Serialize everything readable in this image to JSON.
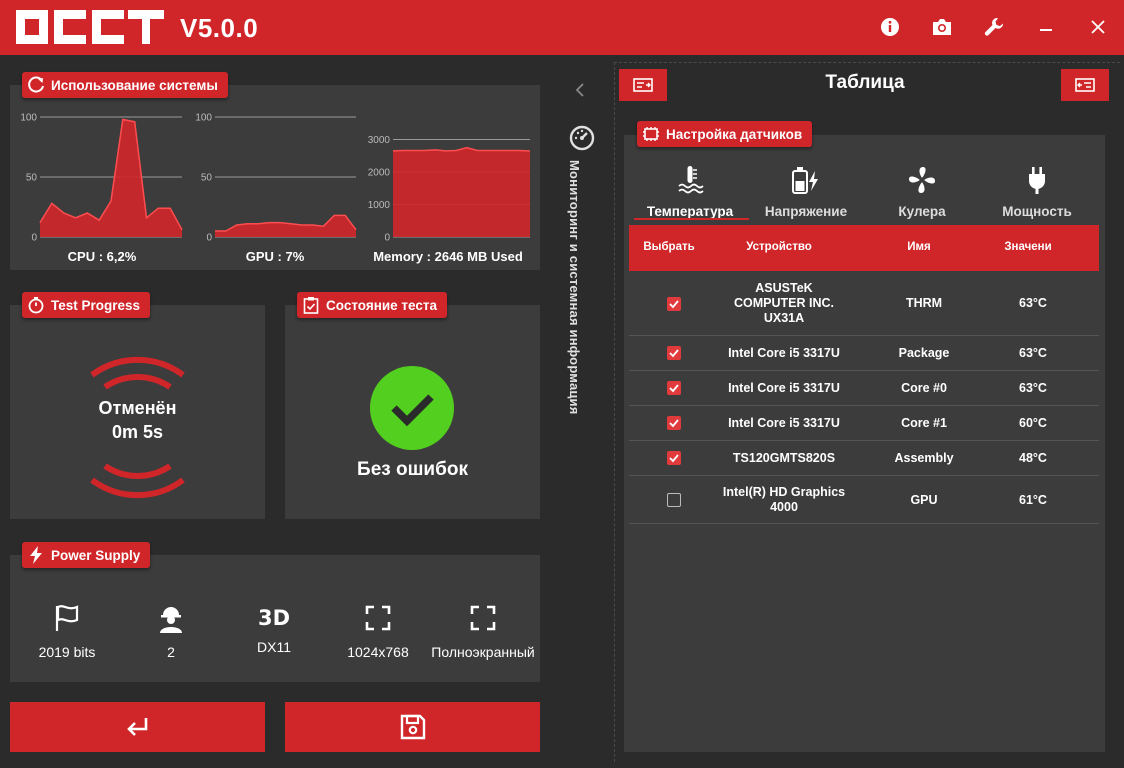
{
  "app": {
    "version": "V5.0.0"
  },
  "colors": {
    "accent": "#d0262a",
    "panel": "#3c3c3c",
    "background": "#2b2b2b",
    "ok_green": "#52cf1f"
  },
  "system_usage": {
    "title": "Использование системы",
    "charts": [
      {
        "name": "cpu",
        "caption": "CPU : 6,2%",
        "ticks": [
          "100",
          "50",
          "0"
        ],
        "ylim": [
          0,
          100
        ]
      },
      {
        "name": "gpu",
        "caption": "GPU : 7%",
        "ticks": [
          "100",
          "50",
          "0"
        ],
        "ylim": [
          0,
          100
        ]
      },
      {
        "name": "memory",
        "caption": "Memory : 2646 MB Used",
        "ticks": [
          "3000",
          "2000",
          "1000",
          "0"
        ],
        "ylim": [
          0,
          3200
        ]
      }
    ]
  },
  "chart_data": [
    {
      "type": "area",
      "series": [
        {
          "values": [
            12,
            28,
            20,
            16,
            20,
            14,
            30,
            98,
            96,
            16,
            24,
            24,
            6
          ]
        }
      ],
      "ylim": [
        0,
        100
      ],
      "xlabel": "CPU : 6,2%"
    },
    {
      "type": "area",
      "series": [
        {
          "values": [
            5,
            5,
            10,
            11,
            11,
            12,
            12,
            11,
            10,
            10,
            9,
            18,
            18,
            6
          ]
        }
      ],
      "ylim": [
        0,
        100
      ],
      "xlabel": "GPU : 7%"
    },
    {
      "type": "area",
      "series": [
        {
          "values": [
            2650,
            2660,
            2660,
            2660,
            2680,
            2650,
            2660,
            2750,
            2660,
            2660,
            2660,
            2660,
            2660,
            2646
          ]
        }
      ],
      "ylim": [
        0,
        3200
      ],
      "xlabel": "Memory : 2646 MB Used"
    }
  ],
  "test_progress": {
    "title": "Test Progress",
    "status": "Отменён",
    "time": "0m 5s"
  },
  "test_state": {
    "title": "Состояние теста",
    "result": "Без ошибок"
  },
  "power_supply": {
    "title": "Power Supply",
    "items": [
      {
        "icon": "flag-icon",
        "label": "2019 bits"
      },
      {
        "icon": "worker-icon",
        "label": "2"
      },
      {
        "icon": "3d-icon",
        "icon_text": "3D",
        "label": "DX11"
      },
      {
        "icon": "fullscreen-icon",
        "label": "1024x768"
      },
      {
        "icon": "fullscreen-icon",
        "label": "Полноэкранный"
      }
    ]
  },
  "side_tab": {
    "label": "Мониторинг и системная информация"
  },
  "right": {
    "title": "Таблица",
    "sensor_settings": "Настройка датчиков",
    "tabs": [
      {
        "label": "Температура",
        "active": true
      },
      {
        "label": "Напряжение",
        "active": false
      },
      {
        "label": "Кулера",
        "active": false
      },
      {
        "label": "Мощность",
        "active": false
      }
    ],
    "columns": [
      "Выбрать",
      "Устройство",
      "Имя",
      "Значени"
    ],
    "rows": [
      {
        "checked": true,
        "device": "ASUSTeK COMPUTER INC. UX31A",
        "name": "THRM",
        "value": "63°C"
      },
      {
        "checked": true,
        "device": "Intel Core i5 3317U",
        "name": "Package",
        "value": "63°C"
      },
      {
        "checked": true,
        "device": "Intel Core i5 3317U",
        "name": "Core #0",
        "value": "63°C"
      },
      {
        "checked": true,
        "device": "Intel Core i5 3317U",
        "name": "Core #1",
        "value": "60°C"
      },
      {
        "checked": true,
        "device": "TS120GMTS820S",
        "name": "Assembly",
        "value": "48°C"
      },
      {
        "checked": false,
        "device": "Intel(R) HD Graphics 4000",
        "name": "GPU",
        "value": "61°C"
      }
    ]
  }
}
